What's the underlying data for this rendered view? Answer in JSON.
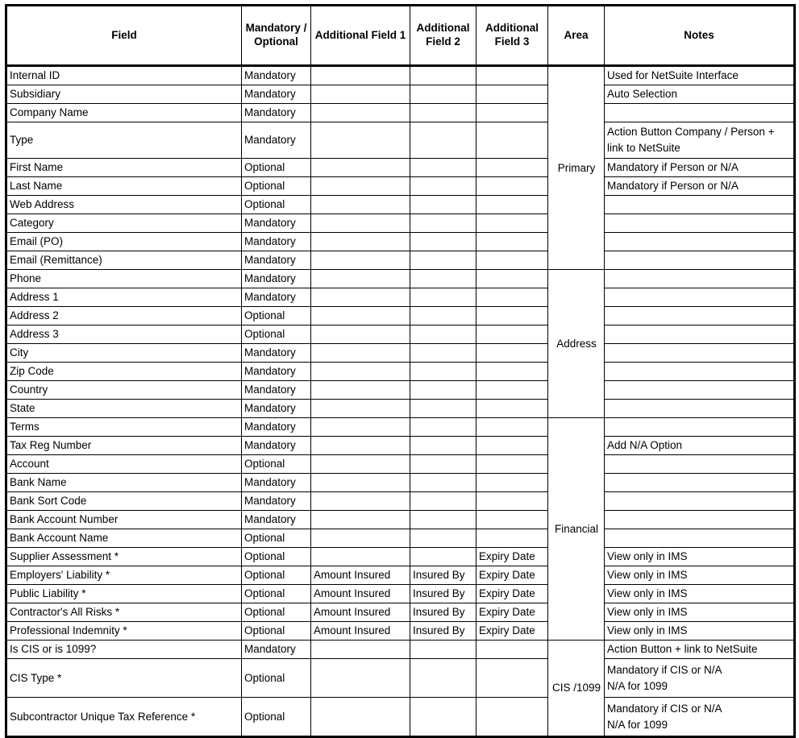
{
  "table": {
    "columns": [
      {
        "key": "field",
        "label": "Field"
      },
      {
        "key": "mo",
        "label": "Mandatory / Optional"
      },
      {
        "key": "af1",
        "label": "Additional Field 1"
      },
      {
        "key": "af2",
        "label": "Additional Field 2"
      },
      {
        "key": "af3",
        "label": "Additional Field 3"
      },
      {
        "key": "area",
        "label": "Area"
      },
      {
        "key": "notes",
        "label": "Notes"
      }
    ],
    "header": {
      "field": "Field",
      "mo_line1": "Mandatory",
      "mo_line2": "/ Optional",
      "af1_line1": "Additional",
      "af1_line2": "Field 1",
      "af2_line1": "Additional",
      "af2_line2": "Field 2",
      "af3_line1": "Additional",
      "af3_line2": "Field 3",
      "area": "Area",
      "notes": "Notes"
    },
    "areas": [
      {
        "label": "Primary",
        "rows": 10
      },
      {
        "label": "Address",
        "rows": 8
      },
      {
        "label": "Financial",
        "rows": 12
      },
      {
        "label": "CIS / 1099",
        "label_line1": "CIS /",
        "label_line2": "1099",
        "rows": 3
      }
    ],
    "rows": [
      {
        "field": "Internal ID",
        "mo": "Mandatory",
        "af1": "",
        "af2": "",
        "af3": "",
        "notes": "Used for NetSuite Interface"
      },
      {
        "field": "Subsidiary",
        "mo": "Mandatory",
        "af1": "",
        "af2": "",
        "af3": "",
        "notes": "Auto Selection"
      },
      {
        "field": "Company Name",
        "mo": "Mandatory",
        "af1": "",
        "af2": "",
        "af3": "",
        "notes": ""
      },
      {
        "field": "Type",
        "mo": "Mandatory",
        "af1": "",
        "af2": "",
        "af3": "",
        "notes": "Action Button Company / Person + link to NetSuite",
        "notes_line1": "Action Button Company / Person +",
        "notes_line2": "link to NetSuite",
        "tall": true
      },
      {
        "field": "First Name",
        "mo": "Optional",
        "af1": "",
        "af2": "",
        "af3": "",
        "notes": "Mandatory if Person or N/A"
      },
      {
        "field": "Last Name",
        "mo": "Optional",
        "af1": "",
        "af2": "",
        "af3": "",
        "notes": "Mandatory if Person or N/A"
      },
      {
        "field": "Web Address",
        "mo": "Optional",
        "af1": "",
        "af2": "",
        "af3": "",
        "notes": ""
      },
      {
        "field": "Category",
        "mo": "Mandatory",
        "af1": "",
        "af2": "",
        "af3": "",
        "notes": ""
      },
      {
        "field": "Email (PO)",
        "mo": "Mandatory",
        "af1": "",
        "af2": "",
        "af3": "",
        "notes": ""
      },
      {
        "field": "Email (Remittance)",
        "mo": "Mandatory",
        "af1": "",
        "af2": "",
        "af3": "",
        "notes": ""
      },
      {
        "field": "Phone",
        "mo": "Mandatory",
        "af1": "",
        "af2": "",
        "af3": "",
        "notes": ""
      },
      {
        "field": "Address 1",
        "mo": "Mandatory",
        "af1": "",
        "af2": "",
        "af3": "",
        "notes": ""
      },
      {
        "field": "Address 2",
        "mo": "Optional",
        "af1": "",
        "af2": "",
        "af3": "",
        "notes": ""
      },
      {
        "field": "Address 3",
        "mo": "Optional",
        "af1": "",
        "af2": "",
        "af3": "",
        "notes": ""
      },
      {
        "field": "City",
        "mo": "Mandatory",
        "af1": "",
        "af2": "",
        "af3": "",
        "notes": ""
      },
      {
        "field": "Zip Code",
        "mo": "Mandatory",
        "af1": "",
        "af2": "",
        "af3": "",
        "notes": ""
      },
      {
        "field": "Country",
        "mo": "Mandatory",
        "af1": "",
        "af2": "",
        "af3": "",
        "notes": ""
      },
      {
        "field": "State",
        "mo": "Mandatory",
        "af1": "",
        "af2": "",
        "af3": "",
        "notes": ""
      },
      {
        "field": "Terms",
        "mo": "Mandatory",
        "af1": "",
        "af2": "",
        "af3": "",
        "notes": ""
      },
      {
        "field": "Tax Reg Number",
        "mo": "Mandatory",
        "af1": "",
        "af2": "",
        "af3": "",
        "notes": "Add N/A Option"
      },
      {
        "field": "Account",
        "mo": "Optional",
        "af1": "",
        "af2": "",
        "af3": "",
        "notes": ""
      },
      {
        "field": "Bank Name",
        "mo": "Mandatory",
        "af1": "",
        "af2": "",
        "af3": "",
        "notes": ""
      },
      {
        "field": "Bank Sort Code",
        "mo": "Mandatory",
        "af1": "",
        "af2": "",
        "af3": "",
        "notes": ""
      },
      {
        "field": "Bank Account Number",
        "mo": "Mandatory",
        "af1": "",
        "af2": "",
        "af3": "",
        "notes": ""
      },
      {
        "field": "Bank Account Name",
        "mo": "Optional",
        "af1": "",
        "af2": "",
        "af3": "",
        "notes": ""
      },
      {
        "field": "Supplier Assessment *",
        "mo": "Optional",
        "af1": "",
        "af2": "",
        "af3": "Expiry Date",
        "notes": "View only in IMS"
      },
      {
        "field": "Employers' Liability *",
        "mo": "Optional",
        "af1": "Amount Insured",
        "af2": "Insured By",
        "af3": "Expiry Date",
        "notes": "View only in IMS"
      },
      {
        "field": "Public Liability *",
        "mo": "Optional",
        "af1": "Amount Insured",
        "af2": "Insured By",
        "af3": "Expiry Date",
        "notes": "View only in IMS"
      },
      {
        "field": "Contractor's All Risks *",
        "mo": "Optional",
        "af1": "Amount Insured",
        "af2": "Insured By",
        "af3": "Expiry Date",
        "notes": "View only in IMS"
      },
      {
        "field": "Professional Indemnity *",
        "mo": "Optional",
        "af1": "Amount Insured",
        "af2": "Insured By",
        "af3": "Expiry Date",
        "notes": "View only in IMS"
      },
      {
        "field": "Is CIS or is 1099?",
        "mo": "Mandatory",
        "af1": "",
        "af2": "",
        "af3": "",
        "notes": "Action Button + link to NetSuite"
      },
      {
        "field": "CIS Type *",
        "mo": "Optional",
        "af1": "",
        "af2": "",
        "af3": "",
        "notes": "Mandatory if CIS or N/A N/A for 1099",
        "notes_line1": "Mandatory if CIS or N/A",
        "notes_line2": "N/A for 1099",
        "tall": true
      },
      {
        "field": "Subcontractor Unique Tax Reference *",
        "mo": "Optional",
        "af1": "",
        "af2": "",
        "af3": "",
        "notes": "Mandatory if CIS or N/A N/A for 1099",
        "notes_line1": "Mandatory if CIS or N/A",
        "notes_line2": "N/A for 1099",
        "tall": true
      }
    ]
  }
}
